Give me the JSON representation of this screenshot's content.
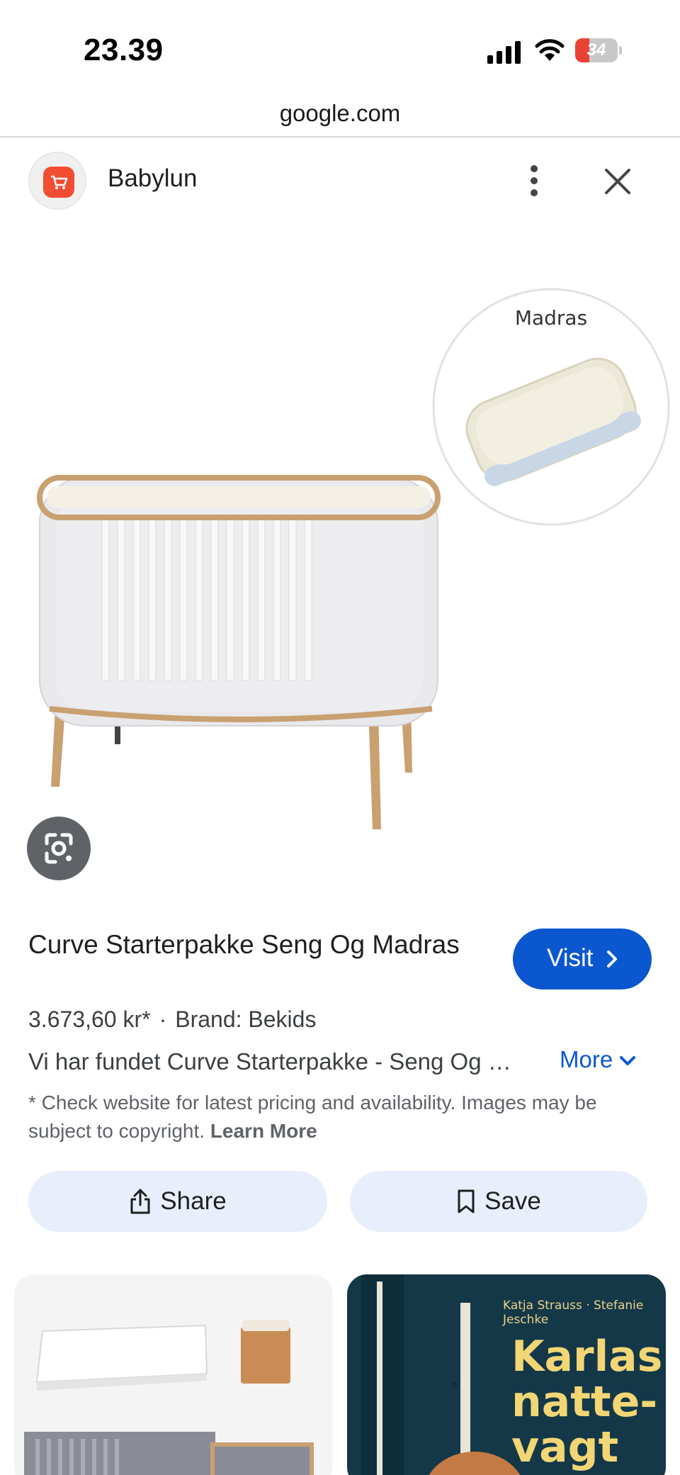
{
  "status_bar": {
    "time": "23.39",
    "battery_level": "34",
    "battery_fraction": 0.34,
    "icons": [
      "cellular-signal-icon",
      "wifi-icon",
      "battery-icon"
    ]
  },
  "url_bar": {
    "url": "google.com"
  },
  "panel_header": {
    "site_name": "Babylun",
    "favicon_icon": "shopping-cart-icon",
    "menu_icon": "more-vert-icon",
    "close_icon": "close-icon"
  },
  "image": {
    "inset_label": "Madras"
  },
  "product": {
    "title": "Curve Starterpakke Seng Og Madras",
    "visit_label": "Visit",
    "price": "3.673,60 kr*",
    "separator": "·",
    "brand": "Brand: Bekids",
    "description": "Vi har fundet Curve Starterpakke - Seng Og Madras",
    "more_label": "More",
    "disclaimer": "* Check website for latest pricing and availability. Images may be subject to copyright.",
    "learn_more_label": "Learn More"
  },
  "actions": {
    "share_label": "Share",
    "save_label": "Save"
  },
  "related": {
    "book_author": "Katja Strauss · Stefanie Jeschke",
    "book_title": "Karlas natte- vagt"
  },
  "colors": {
    "accent_blue": "#0b57d0",
    "action_bg": "#e8eefb",
    "favicon_red": "#f24d33",
    "lens_grey": "#5f6368"
  }
}
